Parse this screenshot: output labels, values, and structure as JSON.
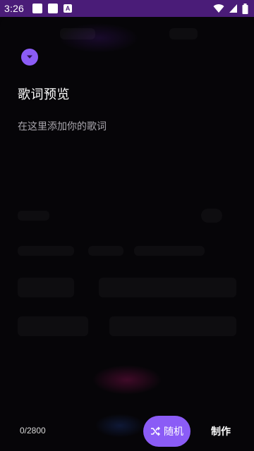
{
  "status_bar": {
    "time": "3:26",
    "notif_icons": [
      "square-notification-icon",
      "square-notification-icon",
      "app-a-icon"
    ],
    "notif_a_glyph": "A",
    "icons": [
      "wifi-icon",
      "signal-icon",
      "battery-icon"
    ],
    "background": "#4a1c78"
  },
  "sheet": {
    "collapse_icon": "chevron-down-icon",
    "title": "歌词预览",
    "lyrics_input": {
      "value": "",
      "placeholder": "在这里添加你的歌词"
    }
  },
  "footer": {
    "char_count": "0/2800",
    "random_button": {
      "icon": "shuffle-icon",
      "label": "随机"
    },
    "make_button_label": "制作"
  },
  "colors": {
    "accent": "#8b5cf6",
    "background": "#060508"
  }
}
